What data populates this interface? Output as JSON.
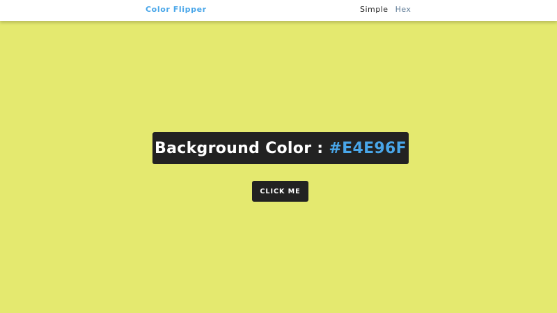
{
  "navbar": {
    "brand": "Color Flipper",
    "links": [
      {
        "label": "Simple",
        "active": true
      },
      {
        "label": "Hex",
        "active": false
      }
    ]
  },
  "main": {
    "label": "Background Color :",
    "hex_value": "#E4E96F",
    "button_label": "CLICK ME"
  },
  "colors": {
    "background": "#E4E96F",
    "accent": "#49A6E9",
    "dark": "#222222",
    "nav_inactive": "#617D98"
  }
}
